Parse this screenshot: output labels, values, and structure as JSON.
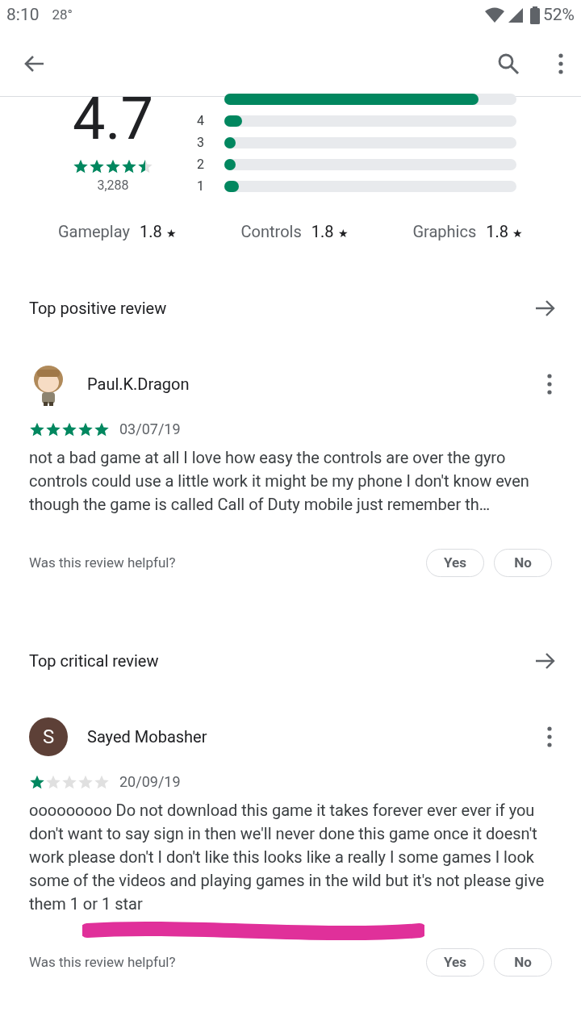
{
  "status_bar": {
    "time": "8:10",
    "temperature": "28°",
    "battery": "52%"
  },
  "rating": {
    "score": "4.7",
    "stars": 4.5,
    "count": "3,288"
  },
  "histogram": [
    {
      "level": 0.87
    },
    {
      "label": "4",
      "level": 0.06
    },
    {
      "label": "3",
      "level": 0.04
    },
    {
      "label": "2",
      "level": 0.04
    },
    {
      "label": "1",
      "level": 0.05
    }
  ],
  "aspects": [
    {
      "name": "Gameplay",
      "value": "1.8",
      "star": "★"
    },
    {
      "name": "Controls",
      "value": "1.8",
      "star": "★"
    },
    {
      "name": "Graphics",
      "value": "1.8",
      "star": "★"
    }
  ],
  "reviews": [
    {
      "heading": "Top positive review",
      "author": "Paul.K.Dragon",
      "avatar": {
        "kind": "picture"
      },
      "stars": 5,
      "date": "03/07/19",
      "text": "not a bad game at all I love how easy the controls are over the gyro controls could use a little work it might be my phone I don't know even though the game is called Call of Duty mobile just remember th…",
      "question": "Was this review helpful?",
      "buttons": [
        "Yes",
        "No"
      ],
      "highlighted": false
    },
    {
      "heading": "Top critical review",
      "author": "Sayed Mobasher",
      "avatar": {
        "kind": "letter",
        "letter": "S",
        "color": "#5d4037"
      },
      "stars": 1,
      "date": "20/09/19",
      "text": "ooooooooo Do not download this game it takes forever ever ever if you don't want to say sign in then we'll never done this game once it doesn't work please don't I don't like this looks like a really I some games I look some of the videos and playing games in the wild but it's not please give them 1 or 1 star",
      "question": "Was this review helpful?",
      "buttons": [
        "Yes",
        "No"
      ],
      "highlighted": true
    }
  ]
}
